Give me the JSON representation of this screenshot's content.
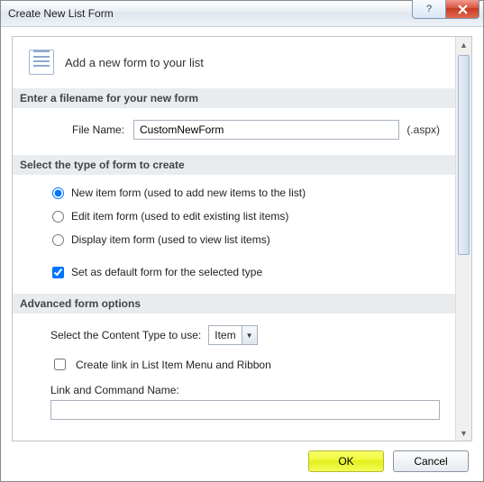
{
  "window": {
    "title": "Create New List Form"
  },
  "header": {
    "text": "Add a new form to your list"
  },
  "sections": {
    "filename": "Enter a filename for your new form",
    "formtype": "Select the type of form to create",
    "advanced": "Advanced form options"
  },
  "filename": {
    "label": "File Name:",
    "value": "CustomNewForm",
    "ext": "(.aspx)"
  },
  "formtype": {
    "options": [
      "New item form (used to add new items to the list)",
      "Edit item form (used to edit existing list items)",
      "Display item form (used to view list items)"
    ],
    "selected_index": 0,
    "default_checkbox": "Set as default form for the selected type",
    "default_checked": true
  },
  "advanced": {
    "content_type_label": "Select the Content Type to use:",
    "content_type_value": "Item",
    "create_link_label": "Create link in List Item Menu and Ribbon",
    "create_link_checked": false,
    "command_name_label": "Link and Command Name:",
    "command_name_value": ""
  },
  "buttons": {
    "ok": "OK",
    "cancel": "Cancel"
  }
}
